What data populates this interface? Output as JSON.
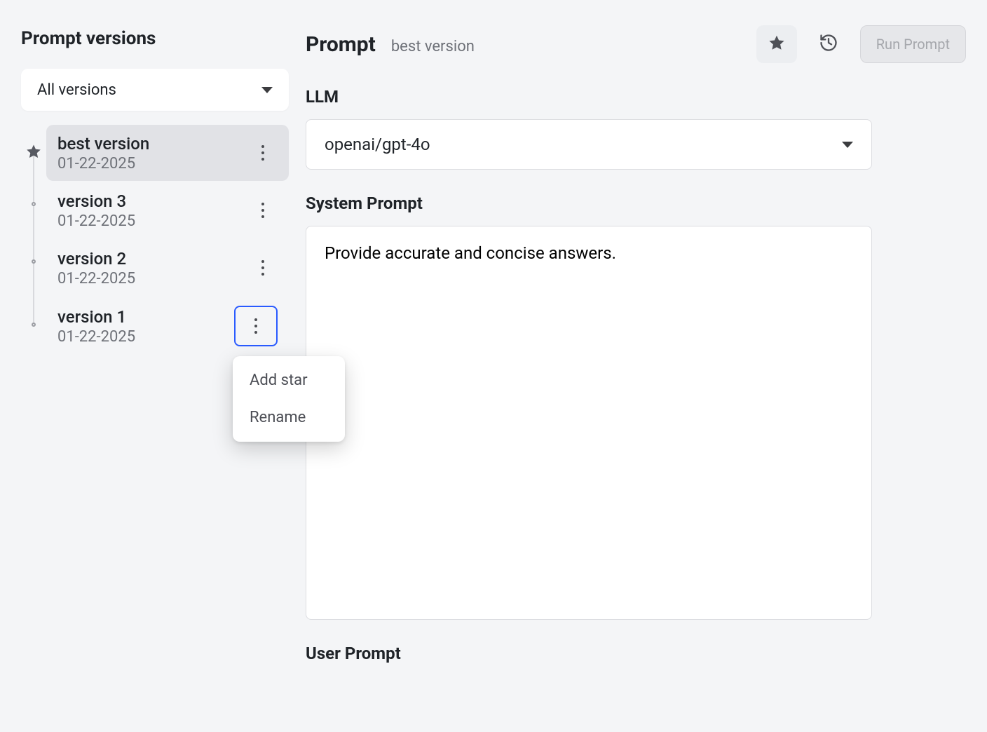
{
  "sidebar": {
    "title": "Prompt versions",
    "filter_label": "All versions",
    "versions": [
      {
        "name": "best version",
        "date": "01-22-2025",
        "starred": true,
        "selected": true,
        "menu_open": false
      },
      {
        "name": "version 3",
        "date": "01-22-2025",
        "starred": false,
        "selected": false,
        "menu_open": false
      },
      {
        "name": "version 2",
        "date": "01-22-2025",
        "starred": false,
        "selected": false,
        "menu_open": false
      },
      {
        "name": "version 1",
        "date": "01-22-2025",
        "starred": false,
        "selected": false,
        "menu_open": true
      }
    ],
    "context_menu": {
      "items": [
        "Add star",
        "Rename"
      ]
    }
  },
  "main": {
    "title": "Prompt",
    "subtitle": "best version",
    "run_button_label": "Run Prompt",
    "llm": {
      "label": "LLM",
      "value": "openai/gpt-4o"
    },
    "system_prompt": {
      "label": "System Prompt",
      "value": "Provide accurate and concise answers."
    },
    "user_prompt": {
      "label": "User Prompt"
    }
  }
}
